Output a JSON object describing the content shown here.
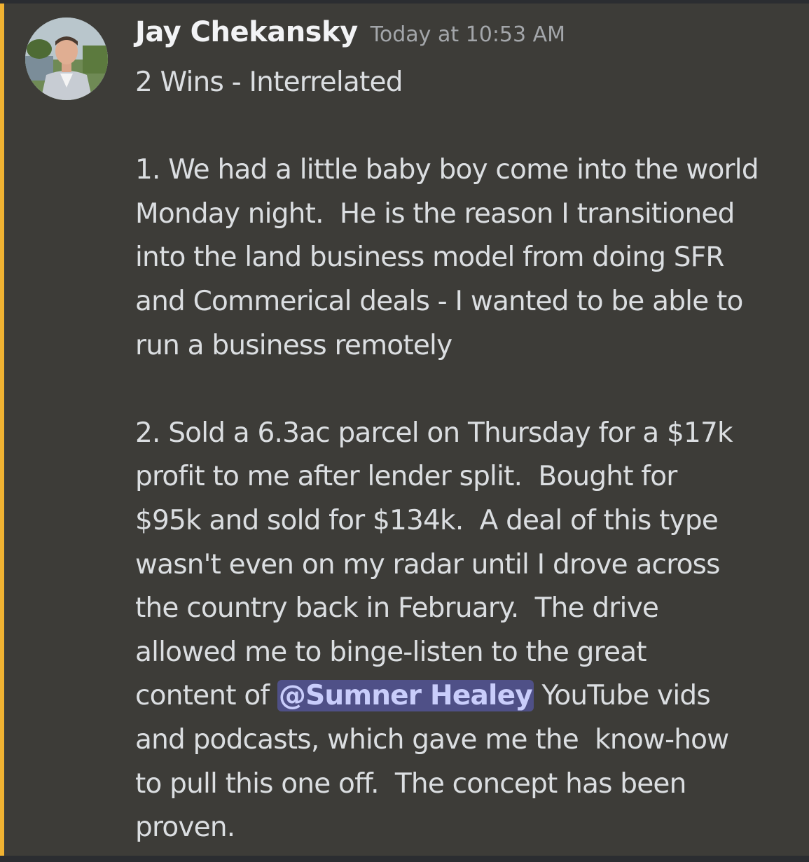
{
  "message": {
    "author": "Jay Chekansky",
    "timestamp": "Today at 10:53 AM",
    "lines": [
      "2 Wins - Interrelated",
      "",
      "1. We had a little baby boy come into the world",
      "Monday night.  He is the reason I transitioned",
      "into the land business model from doing SFR",
      "and Commerical deals - I wanted to be able to",
      "run a business remotely",
      "",
      "2. Sold a 6.3ac parcel on Thursday for a $17k",
      "profit to me after lender split.  Bought for",
      "$95k and sold for $134k.  A deal of this type",
      "wasn't even on my radar until I drove across",
      "the country back in February.  The drive",
      "allowed me to binge-listen to the great"
    ],
    "mention_line": {
      "before": "content of ",
      "mention": "@Sumner Healey",
      "after": " YouTube vids"
    },
    "tail_lines": [
      "and podcasts, which gave me the  know-how",
      "to pull this one off.  The concept has been",
      "proven."
    ]
  },
  "colors": {
    "highlight_bar": "#f0b232",
    "mention_bg": "#4f5087",
    "mention_text": "#c9cdfb"
  }
}
